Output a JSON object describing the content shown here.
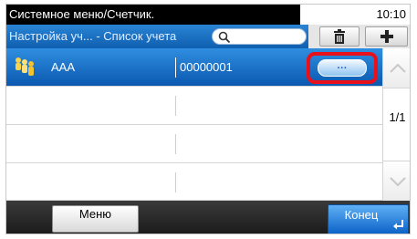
{
  "header": {
    "title": "Системное меню/Счетчик.",
    "time": "10:10"
  },
  "subheader": {
    "list_title": "Настройка уч... - Список учета",
    "search_placeholder": ""
  },
  "accounts": [
    {
      "name": "AAA",
      "number": "00000001",
      "selected": true,
      "detail_label": "···"
    }
  ],
  "pagination": "1/1",
  "footer": {
    "menu_label": "Меню",
    "end_label": "Конец"
  },
  "colors": {
    "selected_row": "#1f76d0",
    "highlight_frame": "#e8111b",
    "title_bg": "#000000",
    "footer_bg": "#262626"
  },
  "icons": [
    "search-icon",
    "trash-icon",
    "add-icon",
    "account-group-icon",
    "scroll-up-icon",
    "scroll-down-icon",
    "enter-icon"
  ]
}
